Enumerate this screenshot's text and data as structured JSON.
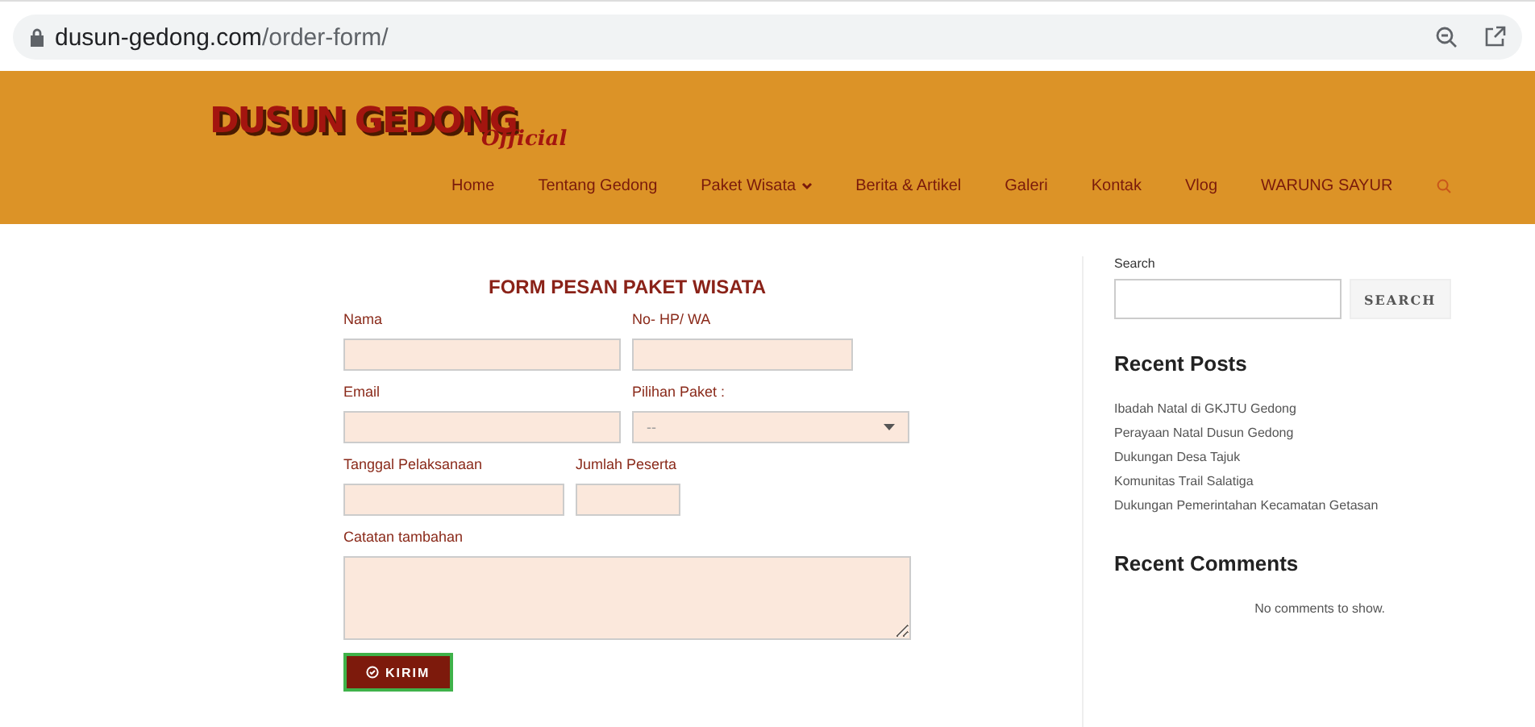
{
  "browser": {
    "url_host": "dusun-gedong.com",
    "url_path": "/order-form/"
  },
  "header": {
    "logo": "DUSUN GEDONG",
    "logo_script": "Official",
    "nav": [
      {
        "label": "Home",
        "dropdown": false
      },
      {
        "label": "Tentang Gedong",
        "dropdown": false
      },
      {
        "label": "Paket Wisata",
        "dropdown": true
      },
      {
        "label": "Berita & Artikel",
        "dropdown": false
      },
      {
        "label": "Galeri",
        "dropdown": false
      },
      {
        "label": "Kontak",
        "dropdown": false
      },
      {
        "label": "Vlog",
        "dropdown": false
      },
      {
        "label": "WARUNG SAYUR",
        "dropdown": false
      }
    ]
  },
  "form": {
    "title": "FORM PESAN PAKET WISATA",
    "rows": [
      [
        {
          "label": "Nama",
          "kind": "text"
        },
        {
          "label": "No- HP/ WA",
          "kind": "text"
        }
      ],
      [
        {
          "label": "Email",
          "kind": "text"
        },
        {
          "label": "Pilihan Paket :",
          "kind": "select",
          "value": "--"
        }
      ],
      [
        {
          "label": "Tanggal Pelaksanaan",
          "kind": "text"
        },
        {
          "label": "Jumlah Peserta",
          "kind": "short"
        }
      ],
      [
        {
          "label": "Catatan tambahan",
          "kind": "textarea"
        }
      ]
    ],
    "submit": "KIRIM"
  },
  "sidebar": {
    "search_label": "Search",
    "search_button": "SEARCH",
    "recent_posts_title": "Recent Posts",
    "recent_posts": [
      "Ibadah Natal di GKJTU Gedong",
      "Perayaan Natal Dusun Gedong",
      "Dukungan Desa Tajuk",
      "Komunitas Trail Salatiga",
      "Dukungan Pemerintahan Kecamatan Getasan"
    ],
    "recent_comments_title": "Recent Comments",
    "no_comments": "No comments to show."
  }
}
